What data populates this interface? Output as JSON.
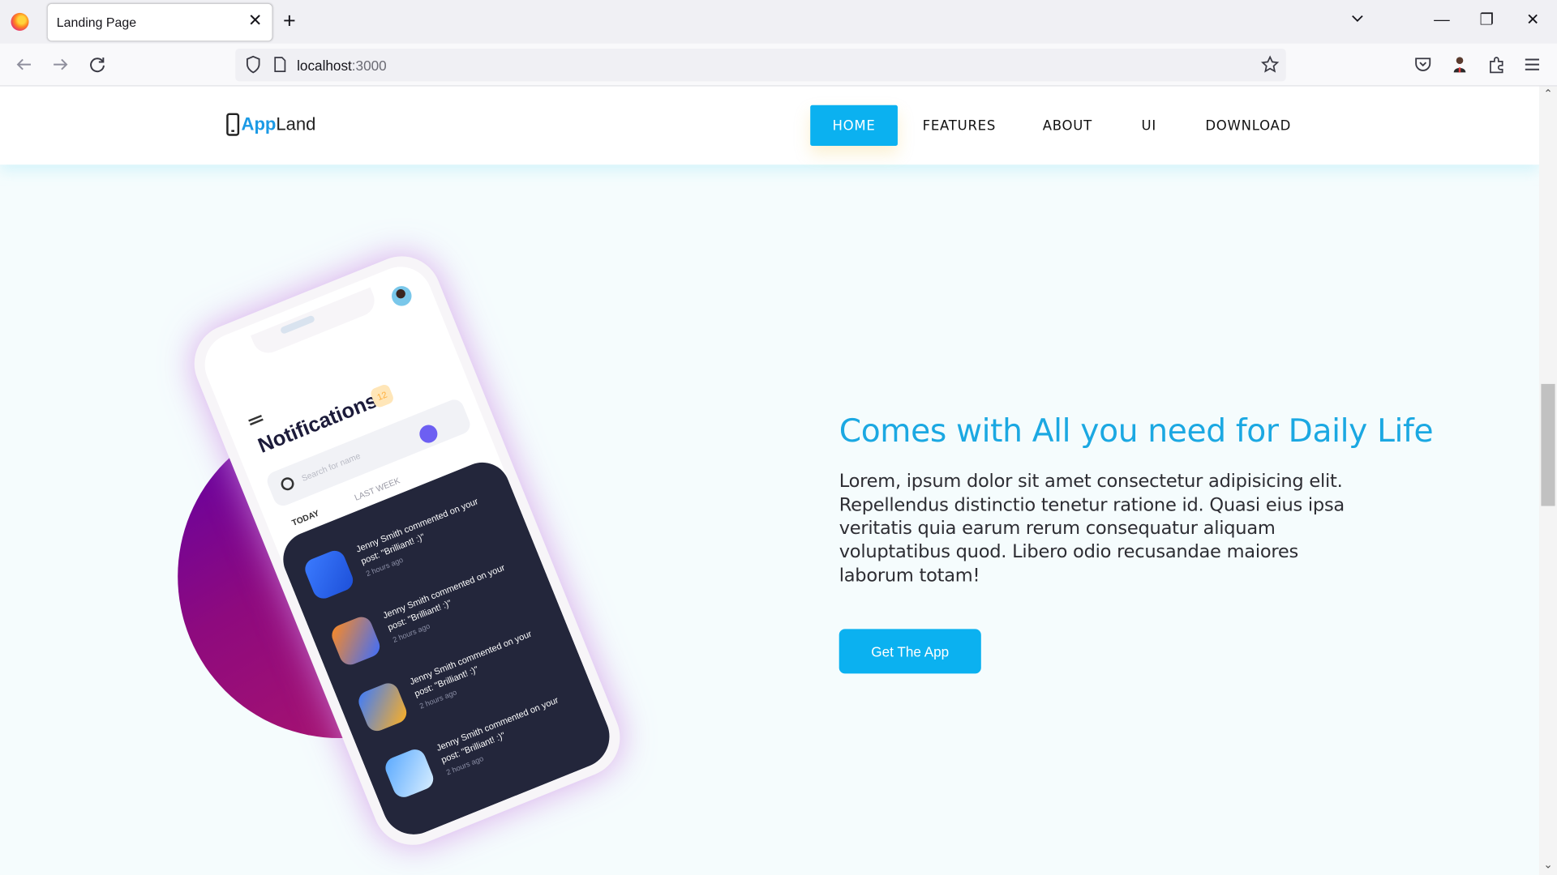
{
  "browser": {
    "tab_title": "Landing Page",
    "tab_close": "✕",
    "new_tab": "+",
    "url_host": "localhost",
    "url_port": ":3000",
    "window_controls": {
      "minimize": "—",
      "restore": "❐",
      "close": "✕"
    }
  },
  "site": {
    "logo_app": "App",
    "logo_land": "Land",
    "nav": [
      "HOME",
      "FEATURES",
      "ABOUT",
      "UI",
      "DOWNLOAD"
    ],
    "active_nav": "HOME",
    "accent_color": "#0bb1f0"
  },
  "phone": {
    "title": "Notifications",
    "badge": "12",
    "search_placeholder": "Search for name",
    "tabs": [
      "TODAY",
      "LAST WEEK"
    ],
    "items": [
      {
        "text": "Jenny Smith commented on your post: \"Brilliant! :)\"",
        "time": "2 hours ago"
      },
      {
        "text": "Jenny Smith commented on your post: \"Brilliant! :)\"",
        "time": "2 hours ago"
      },
      {
        "text": "Jenny Smith commented on your post: \"Brilliant! :)\"",
        "time": "2 hours ago"
      },
      {
        "text": "Jenny Smith commented on your post: \"Brilliant! :)\"",
        "time": "2 hours ago"
      }
    ]
  },
  "hero": {
    "headline": "Comes with All you need for Daily Life",
    "lead": "Lorem, ipsum dolor sit amet consectetur adipisicing elit. Repellendus distinctio tenetur ratione id. Quasi eius ipsa veritatis quia earum rerum consequatur aliquam voluptatibus quod. Libero odio recusandae maiores laborum totam!",
    "cta": "Get The App"
  }
}
